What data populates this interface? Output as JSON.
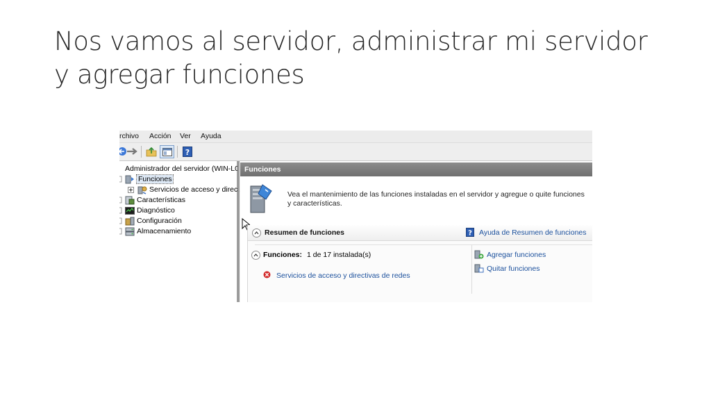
{
  "slide": {
    "title": "Nos vamos al servidor, administrar mi servidor y agregar funciones"
  },
  "menubar": {
    "items": [
      "rchivo",
      "Acción",
      "Ver",
      "Ayuda"
    ]
  },
  "tree": {
    "root": "Administrador del servidor (WIN-L0",
    "items": [
      {
        "label": "Funciones"
      },
      {
        "label": "Servicios de acceso y direct"
      },
      {
        "label": "Características"
      },
      {
        "label": "Diagnóstico"
      },
      {
        "label": "Configuración"
      },
      {
        "label": "Almacenamiento"
      }
    ]
  },
  "detail": {
    "header": "Funciones",
    "description": "Vea el mantenimiento de las funciones instaladas en el servidor y agregue o quite funciones y características.",
    "summary_title": "Resumen de funciones",
    "summary_help": "Ayuda de Resumen de funciones",
    "roles_label": "Funciones:",
    "roles_count": "1 de 17 instalada(s)",
    "role_item": "Servicios de acceso y directivas de redes",
    "add_roles": "Agregar funciones",
    "remove_roles": "Quitar funciones"
  },
  "colors": {
    "header_bg": "#7a7a7a",
    "link": "#1a4f9c",
    "error": "#d22a2a"
  }
}
